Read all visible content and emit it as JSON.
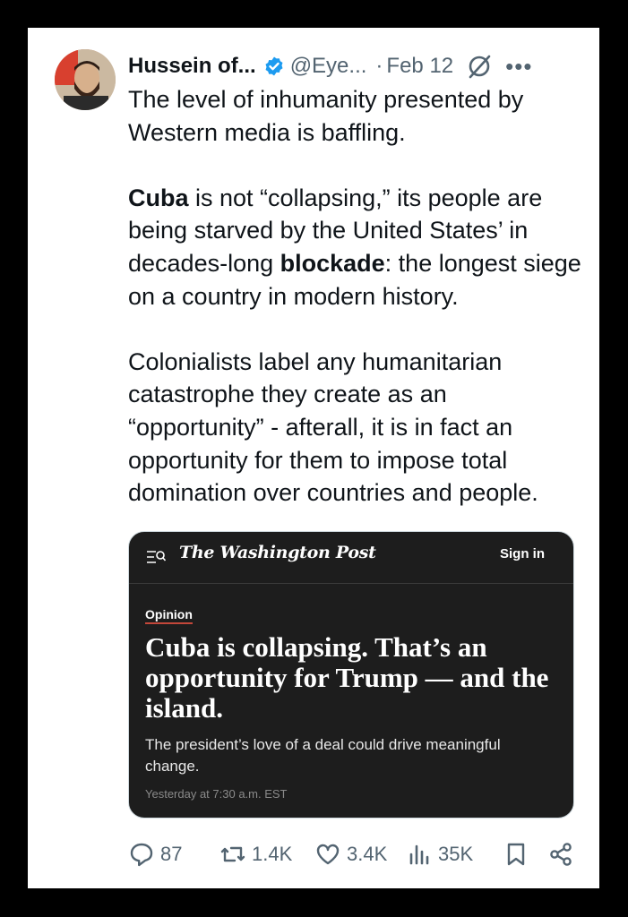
{
  "tweet": {
    "author_name": "Hussein of...",
    "handle": "@Eye...",
    "separator": "·",
    "date": "Feb 12",
    "more": "•••",
    "paragraphs": [
      [
        {
          "t": "The level of inhumanity presented by Western media is baffling.",
          "b": false
        }
      ],
      [
        {
          "t": "Cuba",
          "b": true
        },
        {
          "t": " is not “collapsing,” its people are being starved by the United States’ in decades-long ",
          "b": false
        },
        {
          "t": "blockade",
          "b": true
        },
        {
          "t": ": the longest siege on a country in modern history.",
          "b": false
        }
      ],
      [
        {
          "t": "Colonialists label any humanitarian catastrophe they create as an “opportunity” - afterall, it is in fact an opportunity for them to impose total domination over countries and people.",
          "b": false
        }
      ]
    ]
  },
  "embed": {
    "logo": "The Washington Post",
    "sign_in": "Sign in",
    "section": "Opinion",
    "headline": "Cuba is collapsing. That’s an opportunity for Trump — and the island.",
    "deck": "The president’s love of a deal could drive meaningful change.",
    "timestamp": "Yesterday at 7:30 a.m. EST"
  },
  "actions": {
    "replies": "87",
    "reposts": "1.4K",
    "likes": "3.4K",
    "views": "35K"
  },
  "colors": {
    "verified": "#1d9bf0",
    "text": "#0f1419",
    "muted": "#536471",
    "embed_bg": "#1d1d1d",
    "opinion_underline": "#c3473a"
  }
}
